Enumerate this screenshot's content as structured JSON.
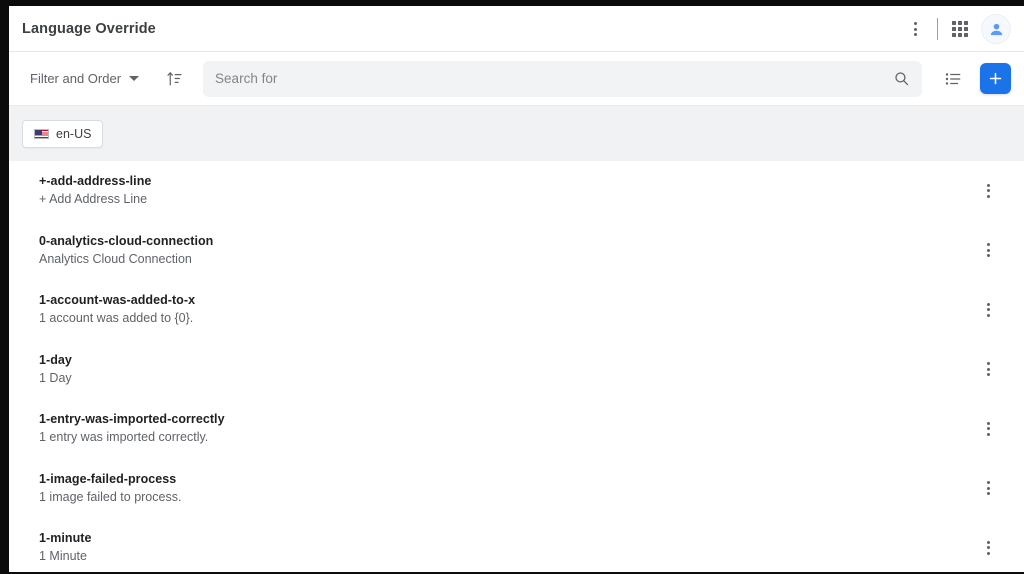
{
  "header": {
    "title": "Language Override",
    "more_menu_icon": "kebab-menu-icon",
    "apps_icon": "apps-grid-icon",
    "avatar_icon": "user-avatar-icon"
  },
  "toolbar": {
    "filter_order_label": "Filter and Order",
    "sort_icon": "sort-ascending-icon",
    "search": {
      "placeholder": "Search for",
      "value": "",
      "icon": "search-icon"
    },
    "list_view_icon": "list-view-icon",
    "add_label": "+",
    "add_icon": "plus-icon",
    "accent_color": "#1a73e8"
  },
  "locale_bar": {
    "chips": [
      {
        "flag": "🇺🇸",
        "label": "en-US"
      }
    ],
    "background_color": "#f1f2f4"
  },
  "list": {
    "row_menu_icon": "kebab-menu-icon",
    "items": [
      {
        "key": "+-add-address-line",
        "value": "+ Add Address Line"
      },
      {
        "key": "0-analytics-cloud-connection",
        "value": "Analytics Cloud Connection"
      },
      {
        "key": "1-account-was-added-to-x",
        "value": "1 account was added to {0}."
      },
      {
        "key": "1-day",
        "value": "1 Day"
      },
      {
        "key": "1-entry-was-imported-correctly",
        "value": "1 entry was imported correctly."
      },
      {
        "key": "1-image-failed-process",
        "value": "1 image failed to process."
      },
      {
        "key": "1-minute",
        "value": "1 Minute"
      }
    ]
  }
}
